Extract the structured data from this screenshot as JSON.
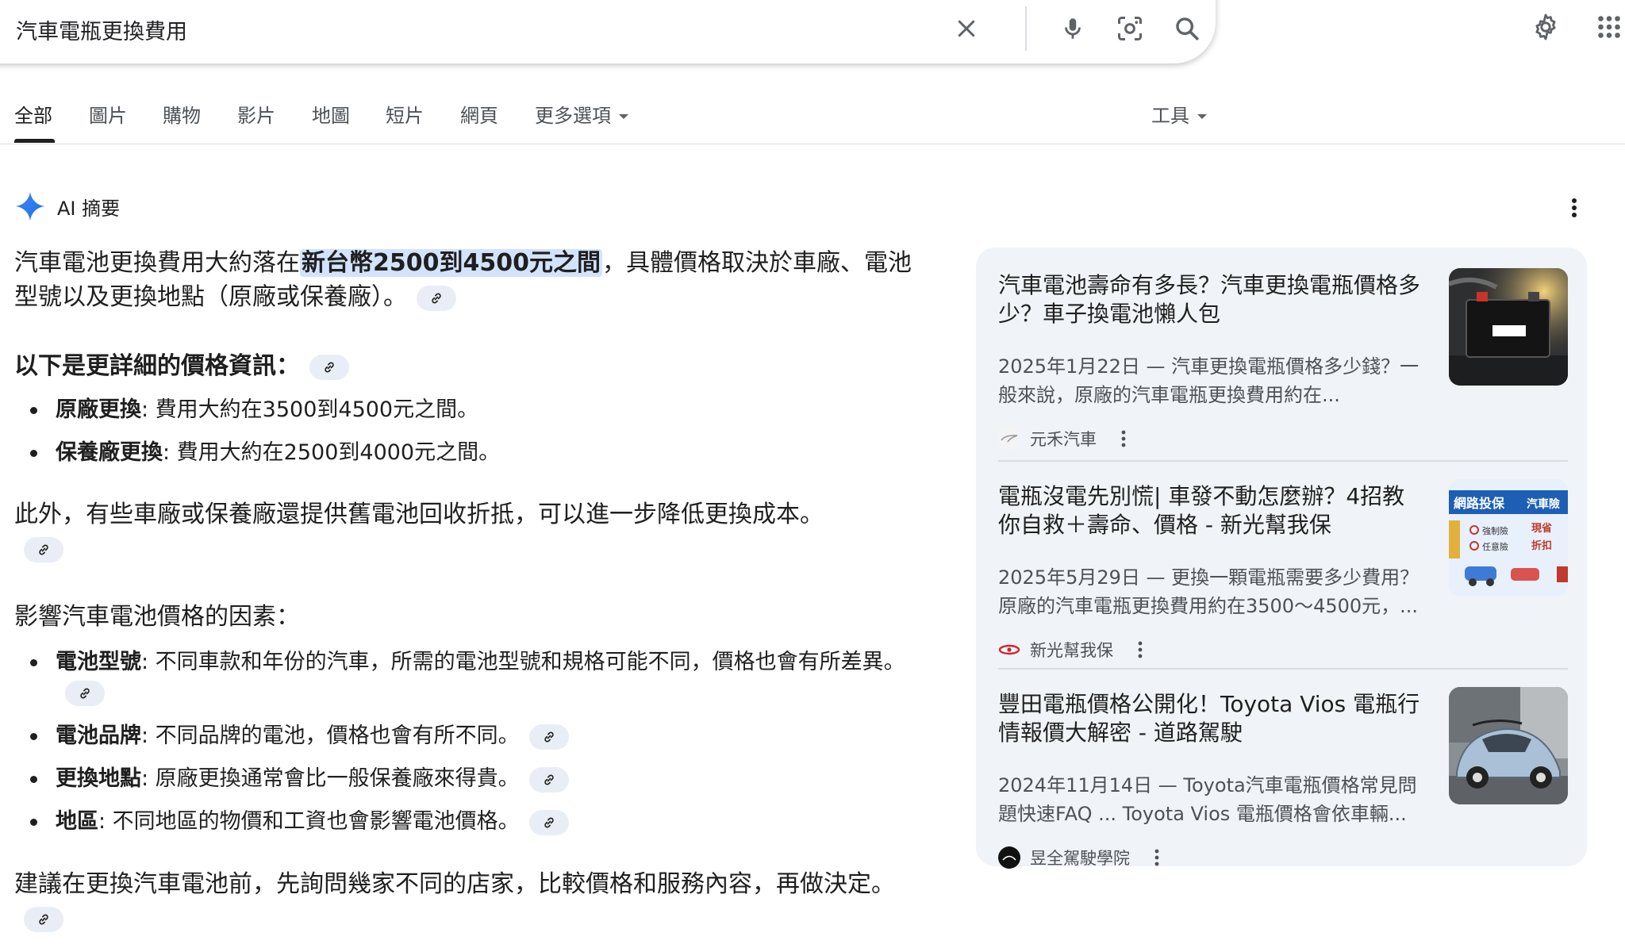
{
  "search": {
    "query": "汽車電瓶更換費用"
  },
  "tabs": [
    {
      "label": "全部",
      "active": true
    },
    {
      "label": "圖片"
    },
    {
      "label": "購物"
    },
    {
      "label": "影片"
    },
    {
      "label": "地圖"
    },
    {
      "label": "短片"
    },
    {
      "label": "網頁"
    },
    {
      "label": "更多選項"
    }
  ],
  "tools_label": "工具",
  "ai_overview": {
    "title": "AI 摘要",
    "intro_before": "汽車電池更換費用大約落在",
    "intro_highlight": "新台幣2500到4500元之間",
    "intro_after": "，具體價格取決於車廠、電池型號以及更換地點（原廠或保養廠）。",
    "details_title": "以下是更詳細的價格資訊：",
    "price_items": [
      {
        "term": "原廠更換",
        "text": ": 費用大約在3500到4500元之間。"
      },
      {
        "term": "保養廠更換",
        "text": ": 費用大約在2500到4000元之間。"
      }
    ],
    "recycle_text": "此外，有些車廠或保養廠還提供舊電池回收折抵，可以進一步降低更換成本。",
    "factors_title": "影響汽車電池價格的因素：",
    "factor_items": [
      {
        "term": "電池型號",
        "text": ": 不同車款和年份的汽車，所需的電池型號和規格可能不同，價格也會有所差異。"
      },
      {
        "term": "電池品牌",
        "text": ": 不同品牌的電池，價格也會有所不同。"
      },
      {
        "term": "更換地點",
        "text": ": 原廠更換通常會比一般保養廠來得貴。"
      },
      {
        "term": "地區",
        "text": ": 不同地區的物價和工資也會影響電池價格。"
      }
    ],
    "advice_text": "建議在更換汽車電池前，先詢問幾家不同的店家，比較價格和服務內容，再做決定。"
  },
  "sources": [
    {
      "title": "汽車電池壽命有多長？汽車更換電瓶價格多少？車子換電池懶人包",
      "snippet": "2025年1月22日 — 汽車更換電瓶價格多少錢？一般來說，原廠的汽車電瓶更換費用約在...",
      "source": "元禾汽車"
    },
    {
      "title": "電瓶沒電先別慌| 車發不動怎麼辦？4招教你自救＋壽命、價格 - 新光幫我保",
      "snippet": "2025年5月29日 — 更換一顆電瓶需要多少費用？原廠的汽車電瓶更換費用約在3500～4500元，...",
      "source": "新光幫我保",
      "thumb_text": {
        "banner": "網路投保",
        "banner2": "汽車險",
        "line1": "強制險",
        "line2": "任意險",
        "promo1": "現省",
        "promo2": "折扣"
      }
    },
    {
      "title": "豐田電瓶價格公開化！Toyota Vios 電瓶行情報價大解密 - 道路駕駛",
      "snippet": "2024年11月14日 — Toyota汽車電瓶價格常見問題快速FAQ ... Toyota Vios 電瓶價格會依車輛...",
      "source": "昱全駕駛學院"
    }
  ],
  "colors": {
    "accent": "#1a73e8",
    "highlight": "#d3e3fd",
    "panel": "#f0f4f9",
    "chip": "#e9eef6"
  }
}
